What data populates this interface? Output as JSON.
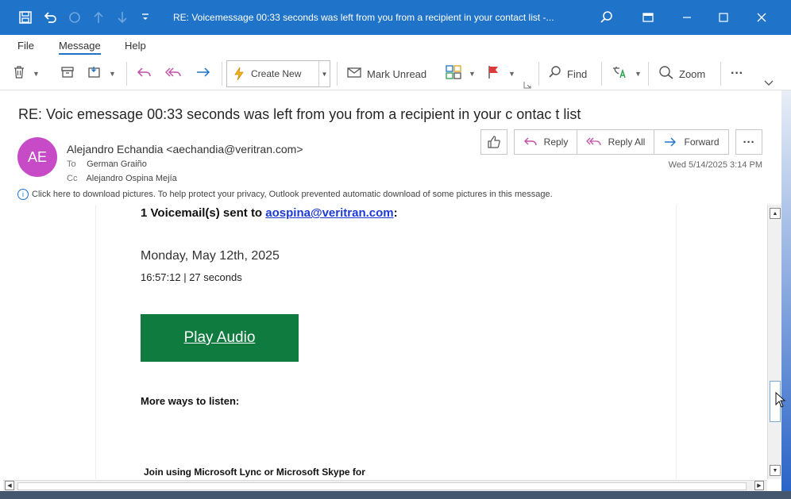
{
  "titlebar": {
    "title": "RE: Voicemessage 00:33 seconds was left from you from a recipient in your contact list  -...",
    "icons": [
      "save-icon",
      "undo-icon",
      "redo-icon",
      "up-arrow-icon",
      "down-arrow-icon",
      "customize-icon",
      "search-icon",
      "restore-icon",
      "minimize-icon",
      "maximize-icon",
      "close-icon"
    ]
  },
  "menu": {
    "file": "File",
    "message": "Message",
    "help": "Help"
  },
  "ribbon": {
    "create_new": "Create New",
    "mark_unread": "Mark Unread",
    "find": "Find",
    "zoom": "Zoom",
    "more": "···"
  },
  "email": {
    "subject": "RE: Voic emessage 00:33 seconds was left from you from a recipient in your c ontac t list",
    "avatar_initials": "AE",
    "avatar_color": "#c74bc6",
    "from": "Alejandro Echandia <aechandia@veritran.com>",
    "to_label": "To",
    "to": "German Graiño",
    "cc_label": "Cc",
    "cc": "Alejandro Ospina Mejía",
    "date": "Wed 5/14/2025 3:14 PM",
    "info_message": "Click here to download pictures. To help protect your privacy, Outlook prevented automatic download of some pictures in this message."
  },
  "actions": {
    "like": "👍",
    "reply": "Reply",
    "reply_all": "Reply All",
    "forward": "Forward",
    "more": "···"
  },
  "body": {
    "vm_sent_prefix": "1 Voicemail(s)  sent to ",
    "vm_email": "aospina@veritran.com",
    "vm_sent_suffix": ":",
    "vm_date": "Monday, May 12th, 2025",
    "vm_time": "16:57:12 |  27 seconds",
    "play_audio": "Play Audio",
    "more_ways": "More ways to listen:",
    "join": "Join using Microsoft Lync or Microsoft Skype for"
  },
  "colors": {
    "accent": "#1f73c8",
    "play_button": "#0f7b3f",
    "link": "#1b3ad6"
  }
}
